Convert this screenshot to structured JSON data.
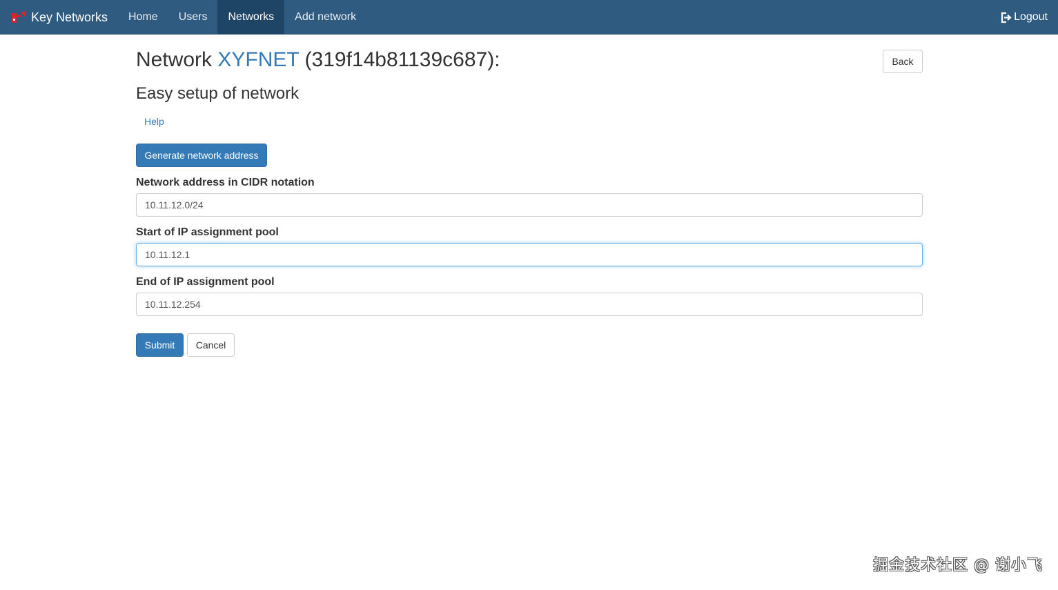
{
  "navbar": {
    "brand": "Key Networks",
    "brand_icon": "key-logo-icon",
    "brand_icon_color": "#d9232e",
    "items": [
      {
        "label": "Home",
        "active": false
      },
      {
        "label": "Users",
        "active": false
      },
      {
        "label": "Networks",
        "active": true
      },
      {
        "label": "Add network",
        "active": false
      }
    ],
    "logout_label": "Logout",
    "logout_icon": "logout-icon",
    "background_color": "#2f5b80"
  },
  "page": {
    "title_prefix": "Network",
    "network_name": "XYFNET",
    "network_id": "(319f14b81139c687):",
    "back_label": "Back",
    "subtitle": "Easy setup of network",
    "help_label": "Help",
    "generate_label": "Generate network address",
    "accent_color": "#337ab7"
  },
  "form": {
    "cidr": {
      "label": "Network address in CIDR notation",
      "value": "10.11.12.0/24"
    },
    "pool_start": {
      "label": "Start of IP assignment pool",
      "value": "10.11.12.1"
    },
    "pool_end": {
      "label": "End of IP assignment pool",
      "value": "10.11.12.254"
    },
    "submit_label": "Submit",
    "cancel_label": "Cancel"
  },
  "watermark": "掘金技术社区 @ 谢小飞"
}
